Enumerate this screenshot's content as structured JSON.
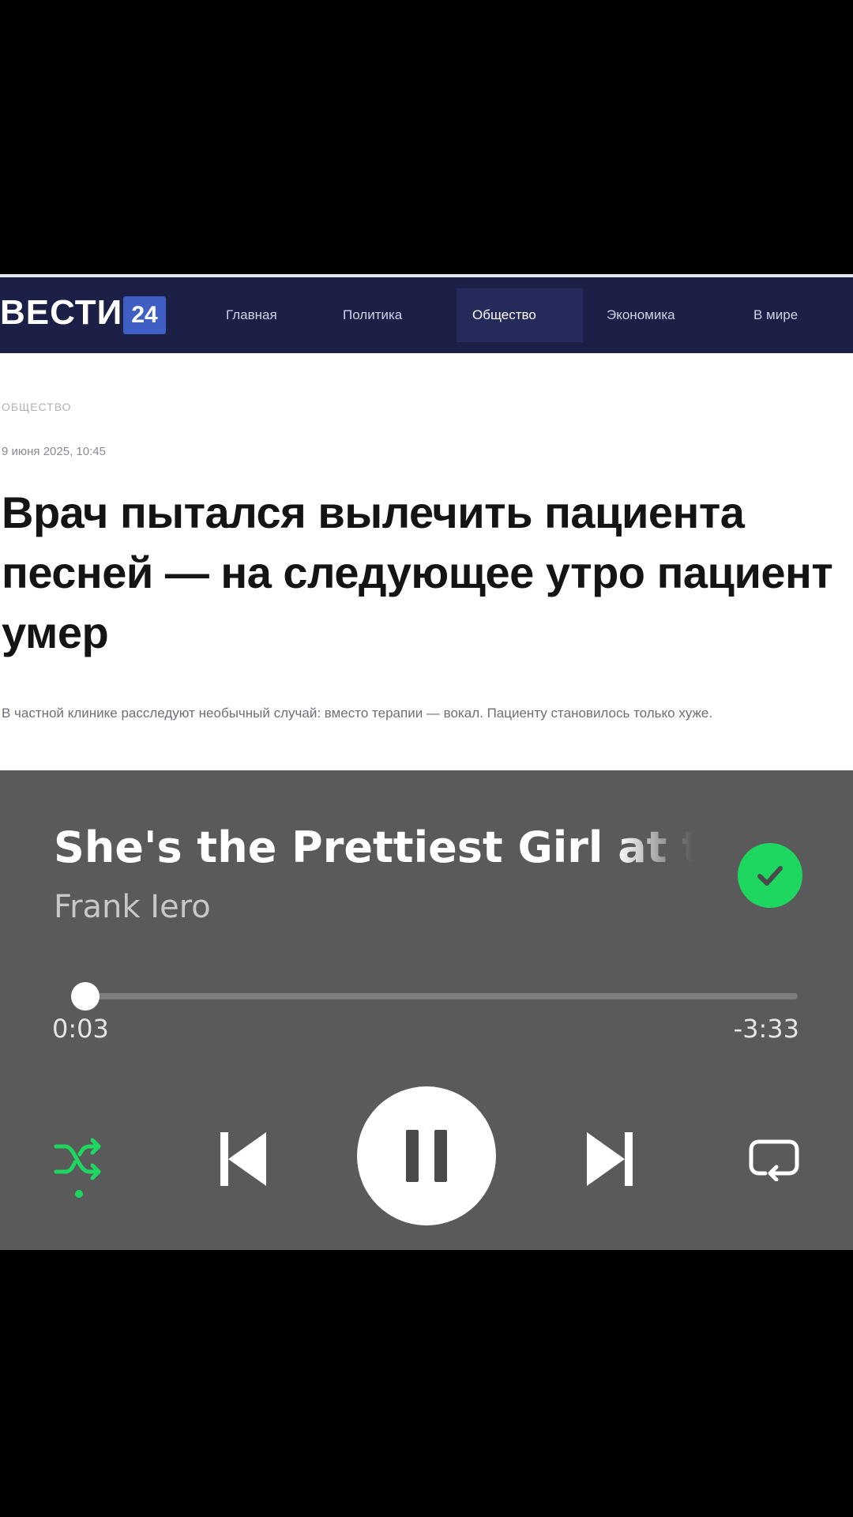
{
  "news": {
    "logo": {
      "text": "ВЕСТИ",
      "badge": "24"
    },
    "nav": [
      {
        "label": "Главная"
      },
      {
        "label": "Политика"
      },
      {
        "label": "Общество",
        "active": true
      },
      {
        "label": "Экономика"
      },
      {
        "label": "В мире"
      }
    ],
    "section": "ОБЩЕСТВО",
    "date": "9 июня 2025, 10:45",
    "headline": "Врач пытался вылечить пациента песней — на следующее утро пациент умер",
    "lede": "В частной клинике расследуют необычный случай: вместо терапии — вокал. Пациенту становилось только хуже.",
    "colors": {
      "header_bg": "#1c2047",
      "badge_bg": "#3f5fc5"
    }
  },
  "player": {
    "track_title": "She's the Prettiest Girl at the Party",
    "artist": "Frank Iero",
    "liked": true,
    "elapsed": "0:03",
    "remaining": "-3:33",
    "progress_fraction": 0.02,
    "shuffle_on": true,
    "is_playing": true,
    "icons": {
      "liked": "check-icon",
      "shuffle": "shuffle-icon",
      "previous": "skip-previous-icon",
      "play_pause": "pause-icon",
      "next": "skip-next-icon",
      "repeat": "repeat-icon"
    },
    "colors": {
      "accent": "#1ed760",
      "background": "#5a5a5a"
    }
  }
}
